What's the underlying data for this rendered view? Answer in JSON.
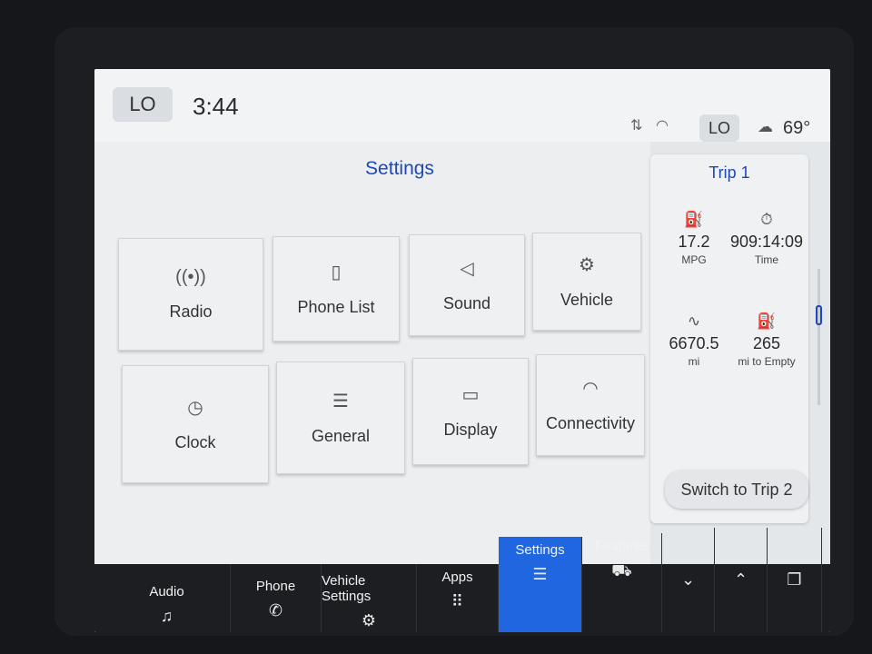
{
  "status_bar": {
    "climate_left": "LO",
    "time": "3:44",
    "signal_icon": "signal-updown-icon",
    "wifi_icon": "wifi-icon",
    "climate_right": "LO",
    "outside_temp": "69°"
  },
  "settings": {
    "title": "Settings",
    "tiles": [
      {
        "label": "Radio",
        "icon": "radio-antenna-icon"
      },
      {
        "label": "Phone List",
        "icon": "phone-list-icon"
      },
      {
        "label": "Sound",
        "icon": "speaker-icon"
      },
      {
        "label": "Vehicle",
        "icon": "vehicle-settings-icon"
      },
      {
        "label": "Clock",
        "icon": "clock-icon"
      },
      {
        "label": "General",
        "icon": "sliders-icon"
      },
      {
        "label": "Display",
        "icon": "display-icon"
      },
      {
        "label": "Connectivity",
        "icon": "wifi-icon"
      }
    ],
    "page_index": 1,
    "page_count": 2
  },
  "trip": {
    "title": "Trip 1",
    "metrics": [
      {
        "value": "17.2",
        "unit": "MPG",
        "icon": "fuel-economy-icon"
      },
      {
        "value": "909:14:09",
        "unit": "Time",
        "icon": "stopwatch-icon"
      },
      {
        "value": "6670.5",
        "unit": "mi",
        "icon": "road-distance-icon"
      },
      {
        "value": "265",
        "unit": "mi to Empty",
        "icon": "fuel-pump-icon"
      }
    ],
    "switch_label": "Switch to Trip 2"
  },
  "nav": {
    "items": [
      {
        "label": "Audio",
        "icon": "music-note-icon"
      },
      {
        "label": "Phone",
        "icon": "phone-icon"
      },
      {
        "label": "Vehicle Settings",
        "icon": "vehicle-settings-icon"
      },
      {
        "label": "Apps",
        "icon": "apps-grid-icon"
      },
      {
        "label": "Settings",
        "icon": "sliders-icon",
        "active": true
      },
      {
        "label": "Features",
        "icon": "car-icon"
      }
    ],
    "controls": [
      "chevron-down-icon",
      "chevron-up-icon",
      "window-stack-icon"
    ]
  },
  "colors": {
    "accent": "#1f66e0",
    "title_blue": "#1e48b8",
    "nav_bg": "#1c1e22"
  }
}
